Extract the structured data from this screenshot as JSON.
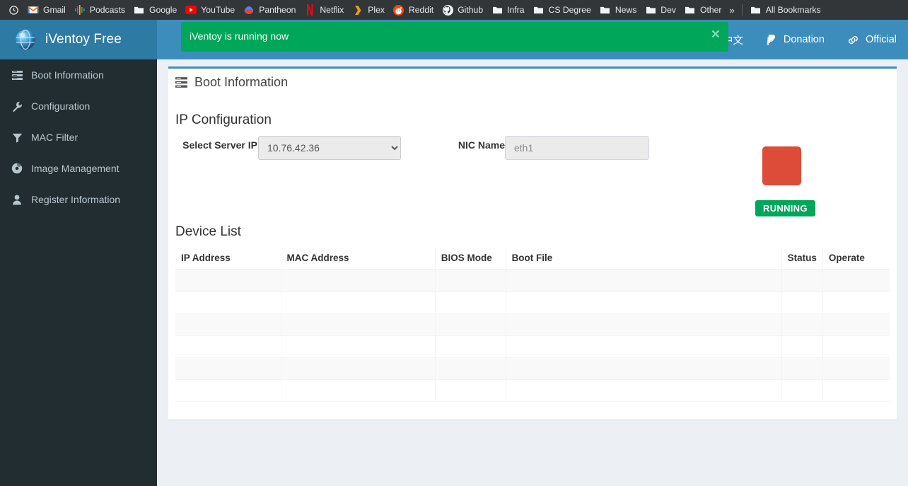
{
  "browser": {
    "bookmarks": [
      {
        "label": "",
        "icon": "history-icon"
      },
      {
        "label": "Gmail",
        "icon": "gmail-icon"
      },
      {
        "label": "Podcasts",
        "icon": "podcasts-icon"
      },
      {
        "label": "Google",
        "icon": "folder-icon"
      },
      {
        "label": "YouTube",
        "icon": "youtube-icon"
      },
      {
        "label": "Pantheon",
        "icon": "pantheon-icon"
      },
      {
        "label": "Netflix",
        "icon": "netflix-icon"
      },
      {
        "label": "Plex",
        "icon": "plex-icon"
      },
      {
        "label": "Reddit",
        "icon": "reddit-icon"
      },
      {
        "label": "Github",
        "icon": "github-icon"
      },
      {
        "label": "Infra",
        "icon": "folder-icon"
      },
      {
        "label": "CS Degree",
        "icon": "folder-icon"
      },
      {
        "label": "News",
        "icon": "folder-icon"
      },
      {
        "label": "Dev",
        "icon": "folder-icon"
      },
      {
        "label": "Other",
        "icon": "folder-icon"
      }
    ],
    "overflow_label": "»",
    "all_bookmarks_label": "All Bookmarks"
  },
  "header": {
    "app_title": "iVentoy Free",
    "logo_icon": "globe-icon",
    "links": [
      {
        "label": "中文",
        "icon": "language-icon"
      },
      {
        "label": "Donation",
        "icon": "paypal-icon"
      },
      {
        "label": "Official",
        "icon": "link-icon"
      }
    ]
  },
  "alert": {
    "message": "iVentoy is running now",
    "close_label": "×",
    "color": "#00a65a"
  },
  "sidebar": {
    "items": [
      {
        "label": "Boot Information",
        "icon": "server-list-icon"
      },
      {
        "label": "Configuration",
        "icon": "wrench-icon"
      },
      {
        "label": "MAC Filter",
        "icon": "filter-icon"
      },
      {
        "label": "Image Management",
        "icon": "disc-icon"
      },
      {
        "label": "Register Information",
        "icon": "user-icon"
      }
    ]
  },
  "main": {
    "panel_title": "Boot Information",
    "panel_title_icon": "server-list-icon",
    "ip_config": {
      "heading": "IP Configuration",
      "server_ip_label": "Select Server IP",
      "server_ip_value": "10.76.42.36",
      "server_ip_options": [
        "10.76.42.36"
      ],
      "nic_label": "NIC Name",
      "nic_value": "eth1",
      "stop_button_label": "",
      "stop_button_color": "#dd4b39",
      "status_badge": "RUNNING",
      "status_badge_color": "#00a65a"
    },
    "device_list": {
      "heading": "Device List",
      "columns": [
        "IP Address",
        "MAC Address",
        "BIOS Mode",
        "Boot File",
        "Status",
        "Operate"
      ],
      "rows": [
        [
          "",
          "",
          "",
          "",
          "",
          ""
        ],
        [
          "",
          "",
          "",
          "",
          "",
          ""
        ],
        [
          "",
          "",
          "",
          "",
          "",
          ""
        ],
        [
          "",
          "",
          "",
          "",
          "",
          ""
        ],
        [
          "",
          "",
          "",
          "",
          "",
          ""
        ],
        [
          "",
          "",
          "",
          "",
          "",
          ""
        ]
      ]
    }
  }
}
